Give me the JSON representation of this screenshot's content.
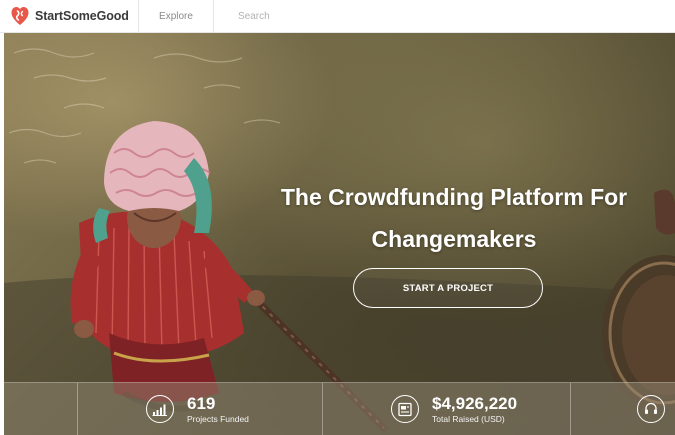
{
  "brand": {
    "name": "StartSomeGood",
    "logo_icon": "heart-logo-icon",
    "color": "#e8574a"
  },
  "nav": {
    "explore_label": "Explore",
    "search_placeholder": "Search"
  },
  "hero": {
    "headline_line1": "The Crowdfunding Platform For",
    "headline_line2": "Changemakers",
    "cta_label": "START A PROJECT"
  },
  "stats": [
    {
      "icon": "bar-chart-icon",
      "value": "619",
      "label": "Projects Funded"
    },
    {
      "icon": "money-document-icon",
      "value": "$4,926,220",
      "label": "Total Raised (USD)"
    },
    {
      "icon": "headset-icon",
      "value": "",
      "label": ""
    }
  ]
}
